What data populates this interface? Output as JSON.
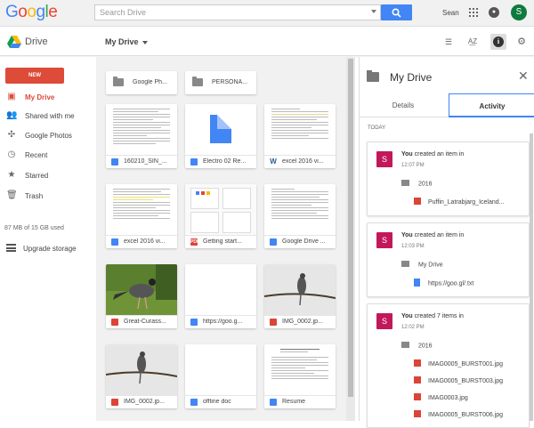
{
  "header": {
    "logo": "Google",
    "search_placeholder": "Search Drive",
    "user_name": "Sean",
    "avatar_letter": "S"
  },
  "subheader": {
    "app_name": "Drive",
    "breadcrumb": "My Drive"
  },
  "sidebar": {
    "new_label": "NEW",
    "items": [
      {
        "label": "My Drive",
        "icon": "drive-icon"
      },
      {
        "label": "Shared with me",
        "icon": "people-icon"
      },
      {
        "label": "Google Photos",
        "icon": "pinwheel-icon"
      },
      {
        "label": "Recent",
        "icon": "clock-icon"
      },
      {
        "label": "Starred",
        "icon": "star-icon"
      },
      {
        "label": "Trash",
        "icon": "trash-icon"
      }
    ],
    "storage": "87 MB of 15 GB used",
    "upgrade": "Upgrade storage"
  },
  "folders": [
    {
      "name": "Google Ph..."
    },
    {
      "name": "PERSONA..."
    }
  ],
  "files": [
    {
      "name": "160210_SIN_...",
      "type": "doc"
    },
    {
      "name": "Electro 02 Re...",
      "type": "doc"
    },
    {
      "name": "excel 2016 vi...",
      "type": "word"
    },
    {
      "name": "excel 2016 vi...",
      "type": "doc"
    },
    {
      "name": "Getting start...",
      "type": "pdf"
    },
    {
      "name": "Google Drive ...",
      "type": "doc"
    },
    {
      "name": "Great-Curass...",
      "type": "img"
    },
    {
      "name": "https://goo.g...",
      "type": "doc"
    },
    {
      "name": "IMG_0002.jp...",
      "type": "img"
    },
    {
      "name": "IMG_0002.jp...",
      "type": "img"
    },
    {
      "name": "offline doc",
      "type": "doc"
    },
    {
      "name": "Resume",
      "type": "doc"
    }
  ],
  "panel": {
    "title": "My Drive",
    "tabs": [
      "Details",
      "Activity"
    ],
    "section": "TODAY",
    "activities": [
      {
        "user": "You",
        "action": "created an item in",
        "time": "12:07 PM",
        "folder": "2016",
        "items": [
          "Puffin_Latrabjarg_Iceland..."
        ]
      },
      {
        "user": "You",
        "action": "created an item in",
        "time": "12:03 PM",
        "folder": "My Drive",
        "items": [
          "https://goo.gl/.txt"
        ]
      },
      {
        "user": "You",
        "action": "created 7 items in",
        "time": "12:02 PM",
        "folder": "2016",
        "items": [
          "IMAG0005_BURST001.jpg",
          "IMAG0005_BURST003.jpg",
          "IMAG0003.jpg",
          "IMAG0005_BURST006.jpg"
        ]
      }
    ]
  },
  "colors": {
    "accent": "#4285f4",
    "new_button": "#dd4b39",
    "avatar_user": "#0f7a3e",
    "activity_avatar": "#c2185b"
  }
}
